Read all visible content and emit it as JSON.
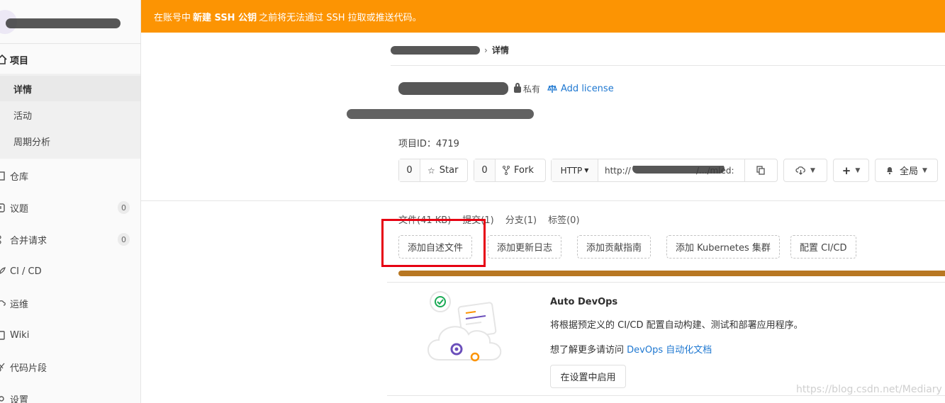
{
  "banner": {
    "prefix": "在账号中",
    "link": "新建 SSH 公钥",
    "suffix": "之前将无法通过 SSH 拉取或推送代码。"
  },
  "sidebar": {
    "project_label": "项目",
    "sub_items": [
      "详情",
      "活动",
      "周期分析"
    ],
    "items": [
      {
        "label": "仓库",
        "icon": "book-icon"
      },
      {
        "label": "议题",
        "icon": "issues-icon",
        "badge": "0"
      },
      {
        "label": "合并请求",
        "icon": "merge-request-icon",
        "badge": "0"
      },
      {
        "label": "CI / CD",
        "icon": "rocket-icon"
      },
      {
        "label": "运维",
        "icon": "cloud-gear-icon"
      },
      {
        "label": "Wiki",
        "icon": "book-open-icon"
      },
      {
        "label": "代码片段",
        "icon": "scissors-icon"
      },
      {
        "label": "设置",
        "icon": "settings-icon"
      }
    ]
  },
  "breadcrumb": {
    "current": "详情"
  },
  "project": {
    "visibility": "私有",
    "license_link": "Add license",
    "id_label": "项目ID：",
    "id_value": "4719"
  },
  "actions": {
    "star_count": "0",
    "star_label": "Star",
    "fork_count": "0",
    "fork_label": "Fork",
    "protocol": "HTTP",
    "clone_url_start": "http://",
    "clone_url_end": "/.../mled:",
    "notification_label": "全局"
  },
  "stats": [
    "文件(41 KB)",
    "提交(1)",
    "分支(1)",
    "标签(0)"
  ],
  "quick_actions": [
    "添加自述文件",
    "添加更新日志",
    "添加贡献指南",
    "添加 Kubernetes 集群",
    "配置 CI/CD"
  ],
  "devops": {
    "title": "Auto DevOps",
    "description": "将根据预定义的 CI/CD 配置自动构建、测试和部署应用程序。",
    "more_prefix": "想了解更多请访问",
    "more_link": "DevOps 自动化文档",
    "enable_button": "在设置中启用"
  },
  "watermark": "https://blog.csdn.net/Mediary",
  "colors": {
    "banner": "#fc9403",
    "link": "#1f78d1",
    "language_bar": "#b87722",
    "highlight": "#e60012"
  }
}
